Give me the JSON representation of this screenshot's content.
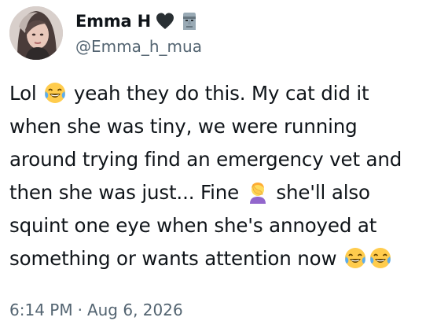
{
  "author": {
    "display_name": "Emma H",
    "handle": "@Emma_h_mua",
    "badges": [
      "black-heart-icon",
      "moai-icon"
    ]
  },
  "tweet": {
    "lines": [
      {
        "before": "Lol",
        "emoji": "joy-emoji",
        "after": "yeah they do this. My cat did it"
      },
      {
        "text": "when she was tiny, we were running"
      },
      {
        "text": "around trying find an emergency vet and"
      },
      {
        "before": "then she was just... Fine",
        "emoji": "facepalm-emoji",
        "after": "she'll also"
      },
      {
        "text": "squint one eye when she's annoyed at"
      },
      {
        "text": "something or wants attention now",
        "trailing_emojis": [
          "joy-emoji",
          "joy-emoji"
        ]
      }
    ]
  },
  "meta": {
    "time": "6:14 PM",
    "separator": "·",
    "date": "Aug 6, 2026"
  },
  "colors": {
    "text": "#0f1419",
    "secondary": "#536471",
    "background": "#ffffff"
  }
}
